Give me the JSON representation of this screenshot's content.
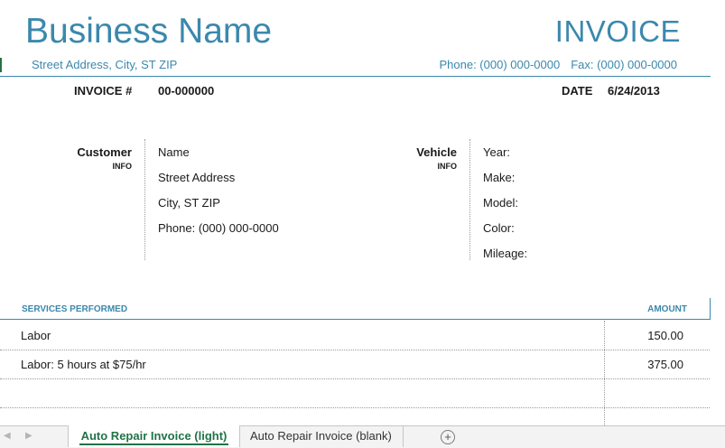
{
  "header": {
    "business_name": "Business Name",
    "doc_title": "INVOICE",
    "street_address": "Street Address, City, ST ZIP",
    "phone": "Phone: (000) 000-0000",
    "fax": "Fax: (000) 000-0000"
  },
  "invoice": {
    "number_label": "INVOICE #",
    "number_value": "00-000000",
    "date_label": "DATE",
    "date_value": "6/24/2013"
  },
  "customer": {
    "heading": "Customer",
    "subheading": "INFO",
    "lines": [
      "Name",
      "Street Address",
      "City, ST ZIP",
      "Phone: (000) 000-0000"
    ]
  },
  "vehicle": {
    "heading": "Vehicle",
    "subheading": "INFO",
    "lines": [
      "Year:",
      "Make:",
      "Model:",
      "Color:",
      "Mileage:"
    ]
  },
  "services": {
    "heading": "SERVICES PERFORMED",
    "amount_heading": "AMOUNT",
    "rows": [
      {
        "description": "Labor",
        "amount": "150.00"
      },
      {
        "description": "Labor: 5 hours at $75/hr",
        "amount": "375.00"
      },
      {
        "description": "",
        "amount": ""
      },
      {
        "description": "",
        "amount": ""
      }
    ]
  },
  "sheet_tabs": {
    "prev_icon": "◀",
    "next_icon": "▶",
    "tabs": [
      "Auto Repair Invoice (light)",
      "Auto Repair Invoice (blank)"
    ],
    "active_index": 0,
    "add_icon": "+"
  },
  "colors": {
    "accent": "#3b88ad",
    "excel_green": "#217346"
  }
}
